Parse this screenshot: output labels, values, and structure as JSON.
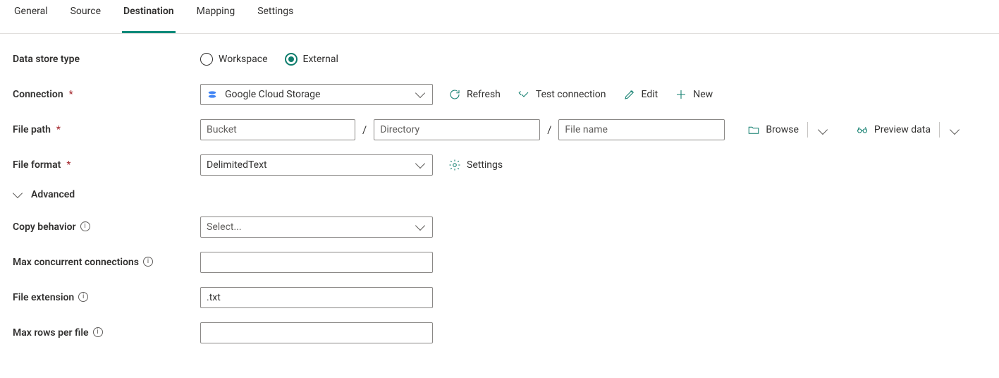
{
  "tabs": {
    "general": "General",
    "source": "Source",
    "destination": "Destination",
    "mapping": "Mapping",
    "settings": "Settings",
    "active": "destination"
  },
  "labels": {
    "data_store_type": "Data store type",
    "connection": "Connection",
    "file_path": "File path",
    "file_format": "File format",
    "advanced": "Advanced",
    "copy_behavior": "Copy behavior",
    "max_concurrent": "Max concurrent connections",
    "file_extension": "File extension",
    "max_rows": "Max rows per file"
  },
  "data_store_type": {
    "workspace": "Workspace",
    "external": "External",
    "selected": "external"
  },
  "connection": {
    "value": "Google Cloud Storage",
    "actions": {
      "refresh": "Refresh",
      "test": "Test connection",
      "edit": "Edit",
      "new": "New"
    }
  },
  "file_path": {
    "bucket_placeholder": "Bucket",
    "bucket_value": "",
    "directory_placeholder": "Directory",
    "directory_value": "",
    "file_name_placeholder": "File name",
    "file_name_value": "",
    "browse": "Browse",
    "preview": "Preview data"
  },
  "file_format": {
    "value": "DelimitedText",
    "settings": "Settings"
  },
  "copy_behavior": {
    "placeholder": "Select...",
    "value": ""
  },
  "max_concurrent_value": "",
  "file_extension_value": ".txt",
  "max_rows_value": ""
}
